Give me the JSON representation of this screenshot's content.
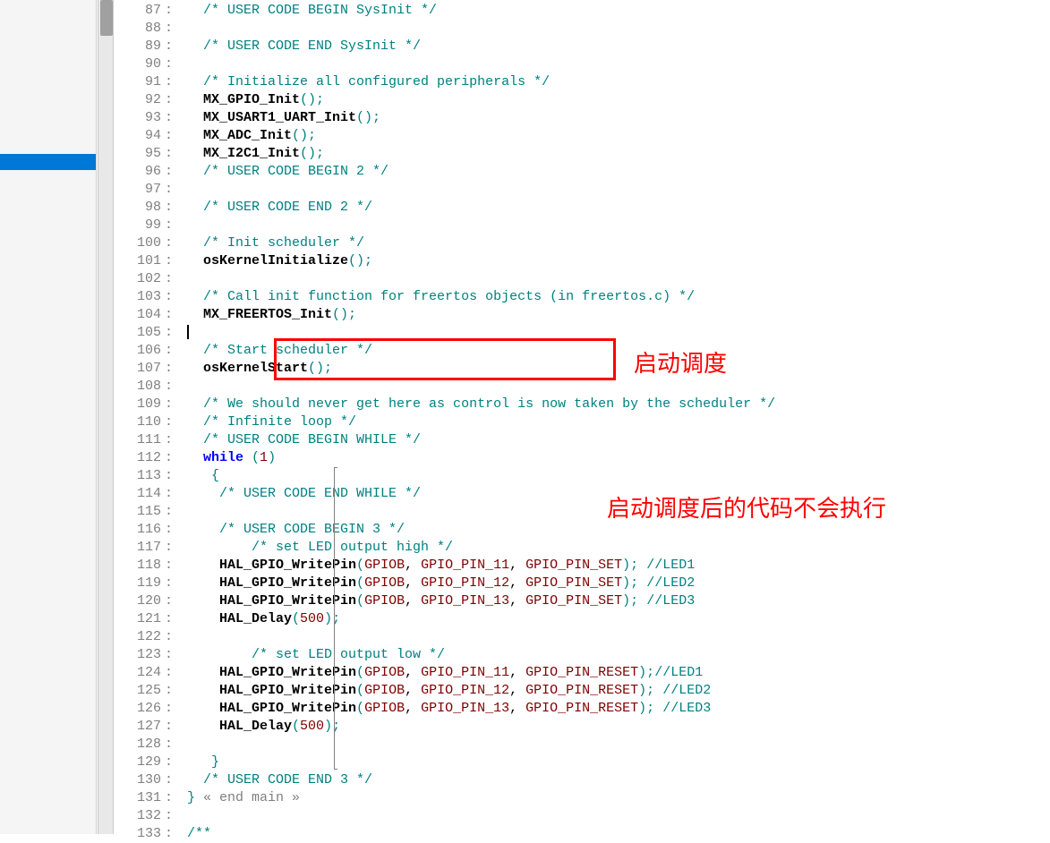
{
  "annotations": {
    "box1_label": "启动调度",
    "box2_label": "启动调度后的代码不会执行"
  },
  "lines": [
    {
      "n": "87",
      "tokens": [
        {
          "t": "   ",
          "c": "c-plain"
        },
        {
          "t": "/* USER CODE BEGIN SysInit */",
          "c": "c-comment"
        }
      ]
    },
    {
      "n": "88",
      "tokens": []
    },
    {
      "n": "89",
      "tokens": [
        {
          "t": "   ",
          "c": "c-plain"
        },
        {
          "t": "/* USER CODE END SysInit */",
          "c": "c-comment"
        }
      ]
    },
    {
      "n": "90",
      "tokens": []
    },
    {
      "n": "91",
      "tokens": [
        {
          "t": "   ",
          "c": "c-plain"
        },
        {
          "t": "/* Initialize all configured peripherals */",
          "c": "c-comment"
        }
      ]
    },
    {
      "n": "92",
      "tokens": [
        {
          "t": "   ",
          "c": "c-plain"
        },
        {
          "t": "MX_GPIO_Init",
          "c": "c-func"
        },
        {
          "t": "();",
          "c": "c-paren"
        }
      ]
    },
    {
      "n": "93",
      "tokens": [
        {
          "t": "   ",
          "c": "c-plain"
        },
        {
          "t": "MX_USART1_UART_Init",
          "c": "c-func"
        },
        {
          "t": "();",
          "c": "c-paren"
        }
      ]
    },
    {
      "n": "94",
      "tokens": [
        {
          "t": "   ",
          "c": "c-plain"
        },
        {
          "t": "MX_ADC_Init",
          "c": "c-func"
        },
        {
          "t": "();",
          "c": "c-paren"
        }
      ]
    },
    {
      "n": "95",
      "tokens": [
        {
          "t": "   ",
          "c": "c-plain"
        },
        {
          "t": "MX_I2C1_Init",
          "c": "c-func"
        },
        {
          "t": "();",
          "c": "c-paren"
        }
      ]
    },
    {
      "n": "96",
      "tokens": [
        {
          "t": "   ",
          "c": "c-plain"
        },
        {
          "t": "/* USER CODE BEGIN 2 */",
          "c": "c-comment"
        }
      ]
    },
    {
      "n": "97",
      "tokens": []
    },
    {
      "n": "98",
      "tokens": [
        {
          "t": "   ",
          "c": "c-plain"
        },
        {
          "t": "/* USER CODE END 2 */",
          "c": "c-comment"
        }
      ]
    },
    {
      "n": "99",
      "tokens": []
    },
    {
      "n": "100",
      "tokens": [
        {
          "t": "   ",
          "c": "c-plain"
        },
        {
          "t": "/* Init scheduler */",
          "c": "c-comment"
        }
      ]
    },
    {
      "n": "101",
      "tokens": [
        {
          "t": "   ",
          "c": "c-plain"
        },
        {
          "t": "osKernelInitialize",
          "c": "c-func"
        },
        {
          "t": "();",
          "c": "c-paren"
        }
      ]
    },
    {
      "n": "102",
      "tokens": []
    },
    {
      "n": "103",
      "tokens": [
        {
          "t": "   ",
          "c": "c-plain"
        },
        {
          "t": "/* Call init function for freertos objects (in freertos.c) */",
          "c": "c-comment"
        }
      ]
    },
    {
      "n": "104",
      "tokens": [
        {
          "t": "   ",
          "c": "c-plain"
        },
        {
          "t": "MX_FREERTOS_Init",
          "c": "c-func"
        },
        {
          "t": "();",
          "c": "c-paren"
        }
      ]
    },
    {
      "n": "105",
      "tokens": [
        {
          "t": " ",
          "c": "c-plain"
        }
      ],
      "cursor": true
    },
    {
      "n": "106",
      "tokens": [
        {
          "t": "   ",
          "c": "c-plain"
        },
        {
          "t": "/* Start scheduler */",
          "c": "c-comment"
        }
      ]
    },
    {
      "n": "107",
      "tokens": [
        {
          "t": "   ",
          "c": "c-plain"
        },
        {
          "t": "osKernelStart",
          "c": "c-func"
        },
        {
          "t": "();",
          "c": "c-paren"
        }
      ]
    },
    {
      "n": "108",
      "tokens": []
    },
    {
      "n": "109",
      "tokens": [
        {
          "t": "   ",
          "c": "c-plain"
        },
        {
          "t": "/* We should never get here as control is now taken by the scheduler */",
          "c": "c-comment"
        }
      ]
    },
    {
      "n": "110",
      "tokens": [
        {
          "t": "   ",
          "c": "c-plain"
        },
        {
          "t": "/* Infinite loop */",
          "c": "c-comment"
        }
      ]
    },
    {
      "n": "111",
      "tokens": [
        {
          "t": "   ",
          "c": "c-plain"
        },
        {
          "t": "/* USER CODE BEGIN WHILE */",
          "c": "c-comment"
        }
      ]
    },
    {
      "n": "112",
      "tokens": [
        {
          "t": "   ",
          "c": "c-plain"
        },
        {
          "t": "while",
          "c": "c-keyword"
        },
        {
          "t": " (",
          "c": "c-paren"
        },
        {
          "t": "1",
          "c": "c-num"
        },
        {
          "t": ")",
          "c": "c-paren"
        }
      ]
    },
    {
      "n": "113",
      "tokens": [
        {
          "t": "    ",
          "c": "c-plain"
        },
        {
          "t": "{",
          "c": "c-paren"
        }
      ]
    },
    {
      "n": "114",
      "tokens": [
        {
          "t": "     ",
          "c": "c-plain"
        },
        {
          "t": "/* USER CODE END WHILE */",
          "c": "c-comment"
        }
      ]
    },
    {
      "n": "115",
      "tokens": []
    },
    {
      "n": "116",
      "tokens": [
        {
          "t": "     ",
          "c": "c-plain"
        },
        {
          "t": "/* USER CODE BEGIN 3 */",
          "c": "c-comment"
        }
      ]
    },
    {
      "n": "117",
      "tokens": [
        {
          "t": "         ",
          "c": "c-plain"
        },
        {
          "t": "/* set LED output high */",
          "c": "c-comment"
        }
      ]
    },
    {
      "n": "118",
      "tokens": [
        {
          "t": "     ",
          "c": "c-plain"
        },
        {
          "t": "HAL_GPIO_WritePin",
          "c": "c-func"
        },
        {
          "t": "(",
          "c": "c-paren"
        },
        {
          "t": "GPIOB",
          "c": "c-macro"
        },
        {
          "t": ", ",
          "c": "c-plain"
        },
        {
          "t": "GPIO_PIN_11",
          "c": "c-macro"
        },
        {
          "t": ", ",
          "c": "c-plain"
        },
        {
          "t": "GPIO_PIN_SET",
          "c": "c-macro"
        },
        {
          "t": "); ",
          "c": "c-paren"
        },
        {
          "t": "//LED1",
          "c": "c-comment"
        }
      ]
    },
    {
      "n": "119",
      "tokens": [
        {
          "t": "     ",
          "c": "c-plain"
        },
        {
          "t": "HAL_GPIO_WritePin",
          "c": "c-func"
        },
        {
          "t": "(",
          "c": "c-paren"
        },
        {
          "t": "GPIOB",
          "c": "c-macro"
        },
        {
          "t": ", ",
          "c": "c-plain"
        },
        {
          "t": "GPIO_PIN_12",
          "c": "c-macro"
        },
        {
          "t": ", ",
          "c": "c-plain"
        },
        {
          "t": "GPIO_PIN_SET",
          "c": "c-macro"
        },
        {
          "t": "); ",
          "c": "c-paren"
        },
        {
          "t": "//LED2",
          "c": "c-comment"
        }
      ]
    },
    {
      "n": "120",
      "tokens": [
        {
          "t": "     ",
          "c": "c-plain"
        },
        {
          "t": "HAL_GPIO_WritePin",
          "c": "c-func"
        },
        {
          "t": "(",
          "c": "c-paren"
        },
        {
          "t": "GPIOB",
          "c": "c-macro"
        },
        {
          "t": ", ",
          "c": "c-plain"
        },
        {
          "t": "GPIO_PIN_13",
          "c": "c-macro"
        },
        {
          "t": ", ",
          "c": "c-plain"
        },
        {
          "t": "GPIO_PIN_SET",
          "c": "c-macro"
        },
        {
          "t": "); ",
          "c": "c-paren"
        },
        {
          "t": "//LED3",
          "c": "c-comment"
        }
      ]
    },
    {
      "n": "121",
      "tokens": [
        {
          "t": "     ",
          "c": "c-plain"
        },
        {
          "t": "HAL_Delay",
          "c": "c-func"
        },
        {
          "t": "(",
          "c": "c-paren"
        },
        {
          "t": "500",
          "c": "c-num"
        },
        {
          "t": ");",
          "c": "c-paren"
        }
      ]
    },
    {
      "n": "122",
      "tokens": []
    },
    {
      "n": "123",
      "tokens": [
        {
          "t": "         ",
          "c": "c-plain"
        },
        {
          "t": "/* set LED output low */",
          "c": "c-comment"
        }
      ]
    },
    {
      "n": "124",
      "tokens": [
        {
          "t": "     ",
          "c": "c-plain"
        },
        {
          "t": "HAL_GPIO_WritePin",
          "c": "c-func"
        },
        {
          "t": "(",
          "c": "c-paren"
        },
        {
          "t": "GPIOB",
          "c": "c-macro"
        },
        {
          "t": ", ",
          "c": "c-plain"
        },
        {
          "t": "GPIO_PIN_11",
          "c": "c-macro"
        },
        {
          "t": ", ",
          "c": "c-plain"
        },
        {
          "t": "GPIO_PIN_RESET",
          "c": "c-macro"
        },
        {
          "t": ");",
          "c": "c-paren"
        },
        {
          "t": "//LED1",
          "c": "c-comment"
        }
      ]
    },
    {
      "n": "125",
      "tokens": [
        {
          "t": "     ",
          "c": "c-plain"
        },
        {
          "t": "HAL_GPIO_WritePin",
          "c": "c-func"
        },
        {
          "t": "(",
          "c": "c-paren"
        },
        {
          "t": "GPIOB",
          "c": "c-macro"
        },
        {
          "t": ", ",
          "c": "c-plain"
        },
        {
          "t": "GPIO_PIN_12",
          "c": "c-macro"
        },
        {
          "t": ", ",
          "c": "c-plain"
        },
        {
          "t": "GPIO_PIN_RESET",
          "c": "c-macro"
        },
        {
          "t": "); ",
          "c": "c-paren"
        },
        {
          "t": "//LED2",
          "c": "c-comment"
        }
      ]
    },
    {
      "n": "126",
      "tokens": [
        {
          "t": "     ",
          "c": "c-plain"
        },
        {
          "t": "HAL_GPIO_WritePin",
          "c": "c-func"
        },
        {
          "t": "(",
          "c": "c-paren"
        },
        {
          "t": "GPIOB",
          "c": "c-macro"
        },
        {
          "t": ", ",
          "c": "c-plain"
        },
        {
          "t": "GPIO_PIN_13",
          "c": "c-macro"
        },
        {
          "t": ", ",
          "c": "c-plain"
        },
        {
          "t": "GPIO_PIN_RESET",
          "c": "c-macro"
        },
        {
          "t": "); ",
          "c": "c-paren"
        },
        {
          "t": "//LED3",
          "c": "c-comment"
        }
      ]
    },
    {
      "n": "127",
      "tokens": [
        {
          "t": "     ",
          "c": "c-plain"
        },
        {
          "t": "HAL_Delay",
          "c": "c-func"
        },
        {
          "t": "(",
          "c": "c-paren"
        },
        {
          "t": "500",
          "c": "c-num"
        },
        {
          "t": ");",
          "c": "c-paren"
        }
      ]
    },
    {
      "n": "128",
      "tokens": []
    },
    {
      "n": "129",
      "tokens": [
        {
          "t": "    ",
          "c": "c-plain"
        },
        {
          "t": "}",
          "c": "c-paren"
        }
      ]
    },
    {
      "n": "130",
      "tokens": [
        {
          "t": "   ",
          "c": "c-plain"
        },
        {
          "t": "/* USER CODE END 3 */",
          "c": "c-comment"
        }
      ]
    },
    {
      "n": "131",
      "tokens": [
        {
          "t": " ",
          "c": "c-plain"
        },
        {
          "t": "}",
          "c": "c-paren"
        },
        {
          "t": " « end main »",
          "c": "c-gray"
        }
      ]
    },
    {
      "n": "132",
      "tokens": []
    },
    {
      "n": "133",
      "tokens": [
        {
          "t": " ",
          "c": "c-plain"
        },
        {
          "t": "/**",
          "c": "c-comment"
        }
      ]
    }
  ]
}
